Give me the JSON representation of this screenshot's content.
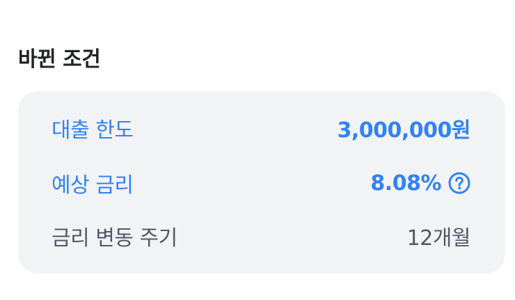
{
  "section": {
    "title": "바뀐 조건"
  },
  "rows": [
    {
      "label": "대출 한도",
      "value": "3,000,000원"
    },
    {
      "label": "예상 금리",
      "value": "8.08%",
      "icon": "question-circle-icon"
    },
    {
      "label": "금리 변동 주기",
      "value": "12개월"
    }
  ],
  "colors": {
    "accent": "#3182f6",
    "text_secondary": "#4e5968",
    "card_background": "#f2f3f5",
    "title": "#222327"
  }
}
